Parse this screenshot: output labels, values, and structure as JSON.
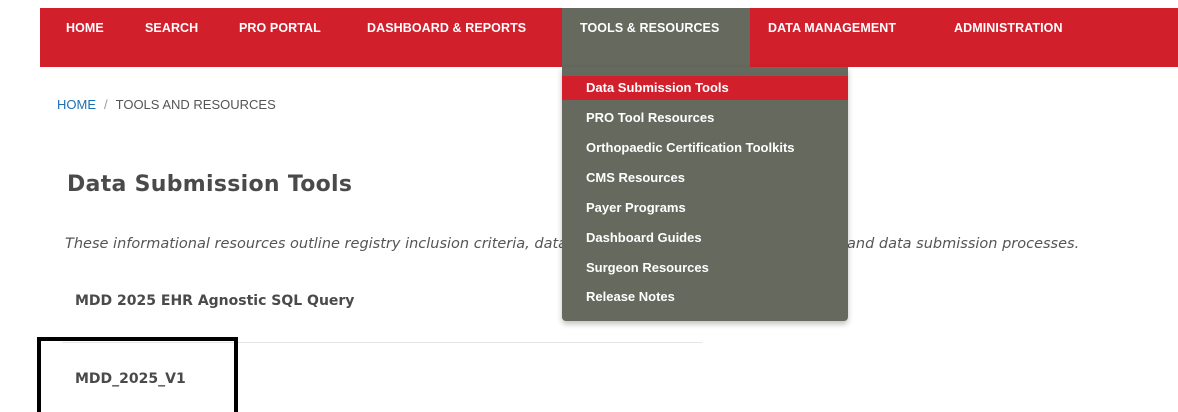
{
  "colors": {
    "brand_red": "#d11f2c",
    "menu_gray": "#666a5e",
    "link_blue": "#1b6fb5"
  },
  "nav": {
    "items": [
      "HOME",
      "SEARCH",
      "PRO PORTAL",
      "DASHBOARD & REPORTS",
      "TOOLS & RESOURCES",
      "DATA MANAGEMENT",
      "ADMINISTRATION"
    ],
    "active": "TOOLS & RESOURCES"
  },
  "dropdown": {
    "items": [
      "Data Submission Tools",
      "PRO Tool Resources",
      "Orthopaedic Certification Toolkits",
      "CMS Resources",
      "Payer Programs",
      "Dashboard Guides",
      "Surgeon Resources",
      "Release Notes"
    ],
    "selected": "Data Submission Tools"
  },
  "breadcrumb": {
    "home": "HOME",
    "separator": "/",
    "current": "TOOLS AND RESOURCES"
  },
  "page": {
    "title": "Data Submission Tools",
    "intro": "These informational resources outline registry inclusion criteria, data element definitions, field summaries, and data submission processes.",
    "files": [
      "MDD 2025 EHR Agnostic SQL Query",
      "MDD_2025_V1"
    ]
  }
}
